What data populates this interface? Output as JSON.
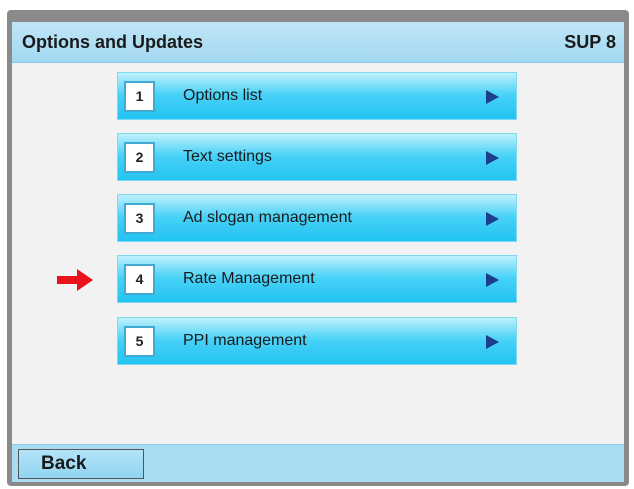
{
  "header": {
    "title": "Options and Updates",
    "code": "SUP 8"
  },
  "menu": {
    "items": [
      {
        "number": "1",
        "label": "Options list"
      },
      {
        "number": "2",
        "label": "Text settings"
      },
      {
        "number": "3",
        "label": "Ad slogan management"
      },
      {
        "number": "4",
        "label": "Rate Management"
      },
      {
        "number": "5",
        "label": "PPI management"
      }
    ],
    "highlighted_item": "4"
  },
  "footer": {
    "back_label": "Back"
  },
  "colors": {
    "header_bg": "#a3d8f1",
    "button_bg": "#22c4f1",
    "arrow_icon": "#1d3f8b",
    "pointer_arrow": "#e8141c"
  },
  "icons": {
    "item_arrow": "play-triangle-icon",
    "pointer": "red-arrow-icon"
  }
}
